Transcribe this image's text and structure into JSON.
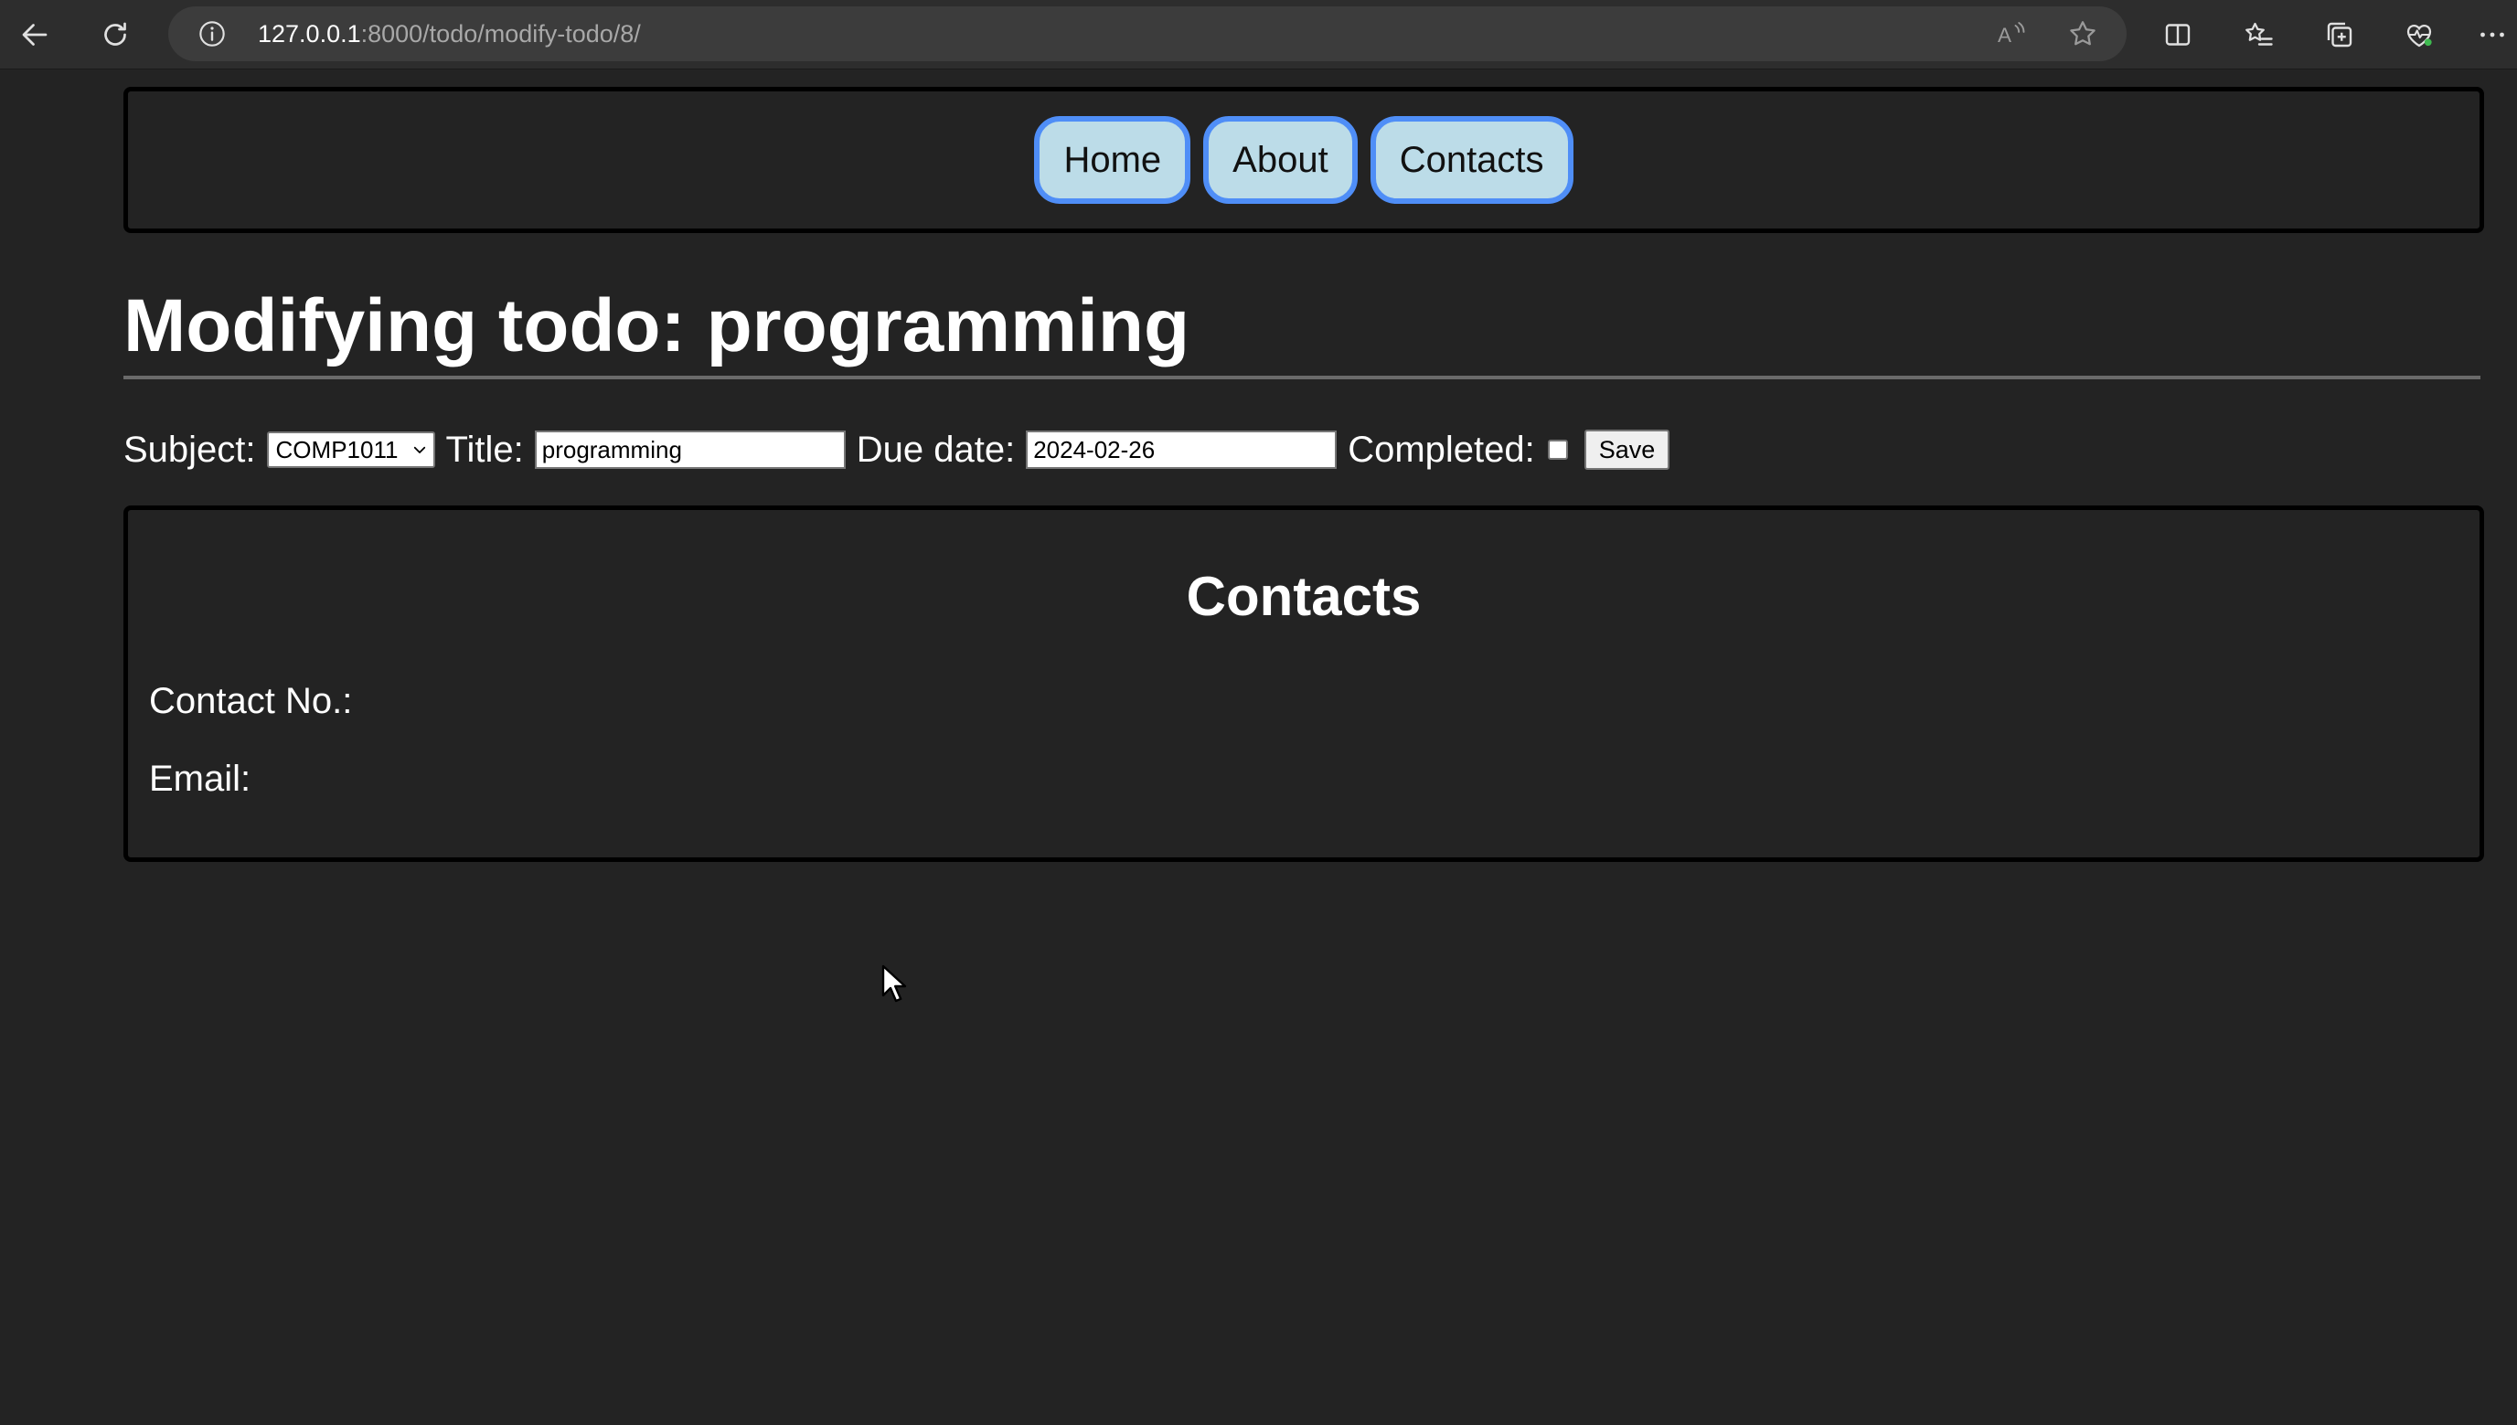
{
  "browser": {
    "url_host": "127.0.0.1",
    "url_rest": ":8000/todo/modify-todo/8/",
    "icons": [
      "back-arrow-icon",
      "refresh-icon",
      "info-icon",
      "read-aloud-icon",
      "favorite-star-icon",
      "split-screen-icon",
      "favorites-list-icon",
      "collections-icon",
      "health-icon",
      "more-options-icon"
    ]
  },
  "nav": {
    "home_label": "Home",
    "about_label": "About",
    "contacts_label": "Contacts"
  },
  "page": {
    "title": "Modifying todo: programming"
  },
  "form": {
    "subject_label": "Subject:",
    "subject_value": "COMP1011",
    "title_label": "Title:",
    "title_value": "programming",
    "due_label": "Due date:",
    "due_value": "2024-02-26",
    "completed_label": "Completed:",
    "completed_checked": false,
    "save_label": "Save"
  },
  "contacts": {
    "heading": "Contacts",
    "contact_no_label": "Contact No.:",
    "email_label": "Email:"
  },
  "colors": {
    "page_bg": "#232323",
    "nav_button_bg": "#bcdce8",
    "nav_button_border": "#4f8ef7"
  }
}
